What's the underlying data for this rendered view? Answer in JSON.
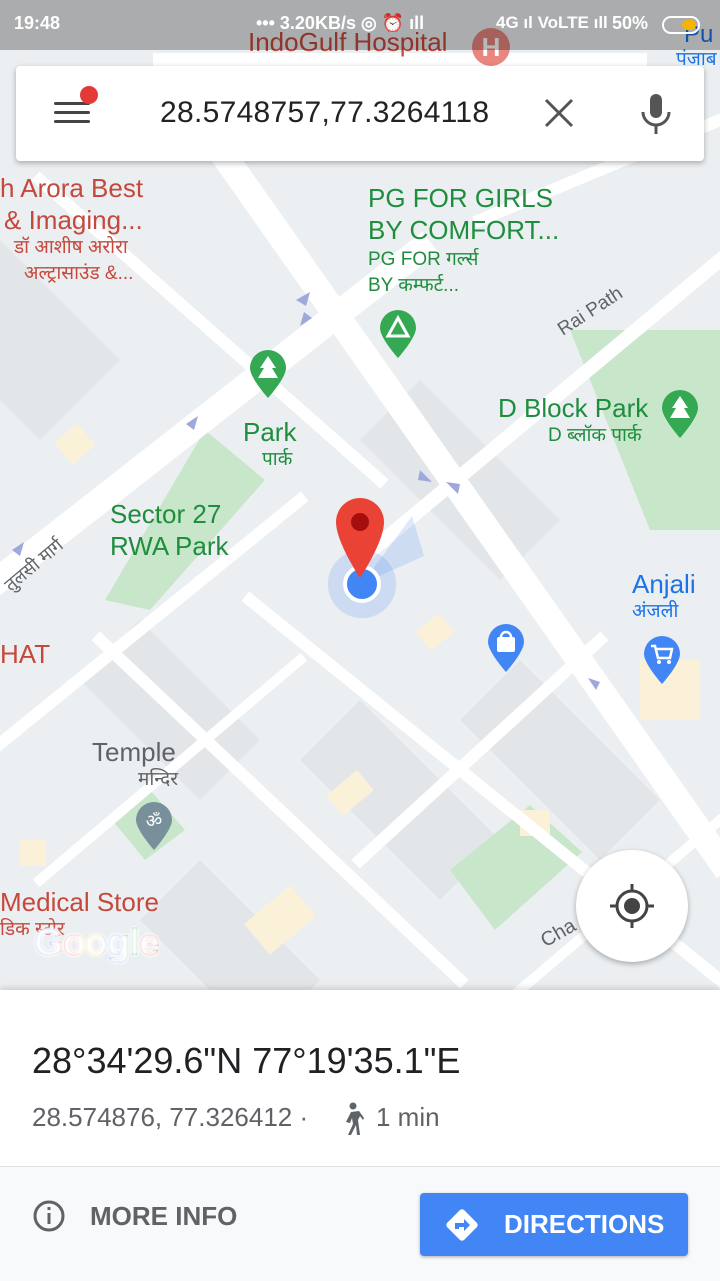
{
  "status_bar": {
    "time": "19:48",
    "network_speed": "3.20KB/s",
    "network_type": "4G",
    "battery": "50%"
  },
  "search": {
    "value": "28.5748757,77.3264118"
  },
  "map": {
    "labels": {
      "top_place": "IndoGulf Hospital",
      "top_right_place": "Pu",
      "top_right_hindi": "पंजाब",
      "clinic_line1": "h Arora Best",
      "clinic_line2": "& Imaging...",
      "clinic_hindi1": "डॉ आशीष अरोरा",
      "clinic_hindi2": "अल्ट्रासाउंड &...",
      "pg_line1": "PG FOR GIRLS",
      "pg_line2": "BY COMFORT...",
      "pg_hindi1": "PG FOR गर्ल्स",
      "pg_hindi2": "BY कम्फर्ट...",
      "rai_path": "Rai Path",
      "d_block_park": "D Block Park",
      "d_block_park_hindi": "D ब्लॉक पार्क",
      "park": "Park",
      "park_hindi": "पार्क",
      "sector27_line1": "Sector 27",
      "sector27_line2": "RWA Park",
      "tulsi_marg": "तुलसी मार्ग",
      "anjali": "Anjali",
      "anjali_hindi": "अंजली",
      "hat": "HAT",
      "temple": "Temple",
      "temple_hindi": "मन्दिर",
      "medical_store": "Medical Store",
      "medical_store_hindi": "डिक स्टोर",
      "cha": "Cha"
    },
    "google_logo": "Google"
  },
  "place": {
    "dms": "28°34'29.6\"N 77°19'35.1\"E",
    "decimal": "28.574876, 77.326412 ·",
    "walk_time": "1 min"
  },
  "actions": {
    "more_info": "MORE INFO",
    "directions": "DIRECTIONS"
  },
  "colors": {
    "accent": "#4285f4",
    "park_green": "#c8e6c9",
    "pin_red": "#ea4335"
  }
}
